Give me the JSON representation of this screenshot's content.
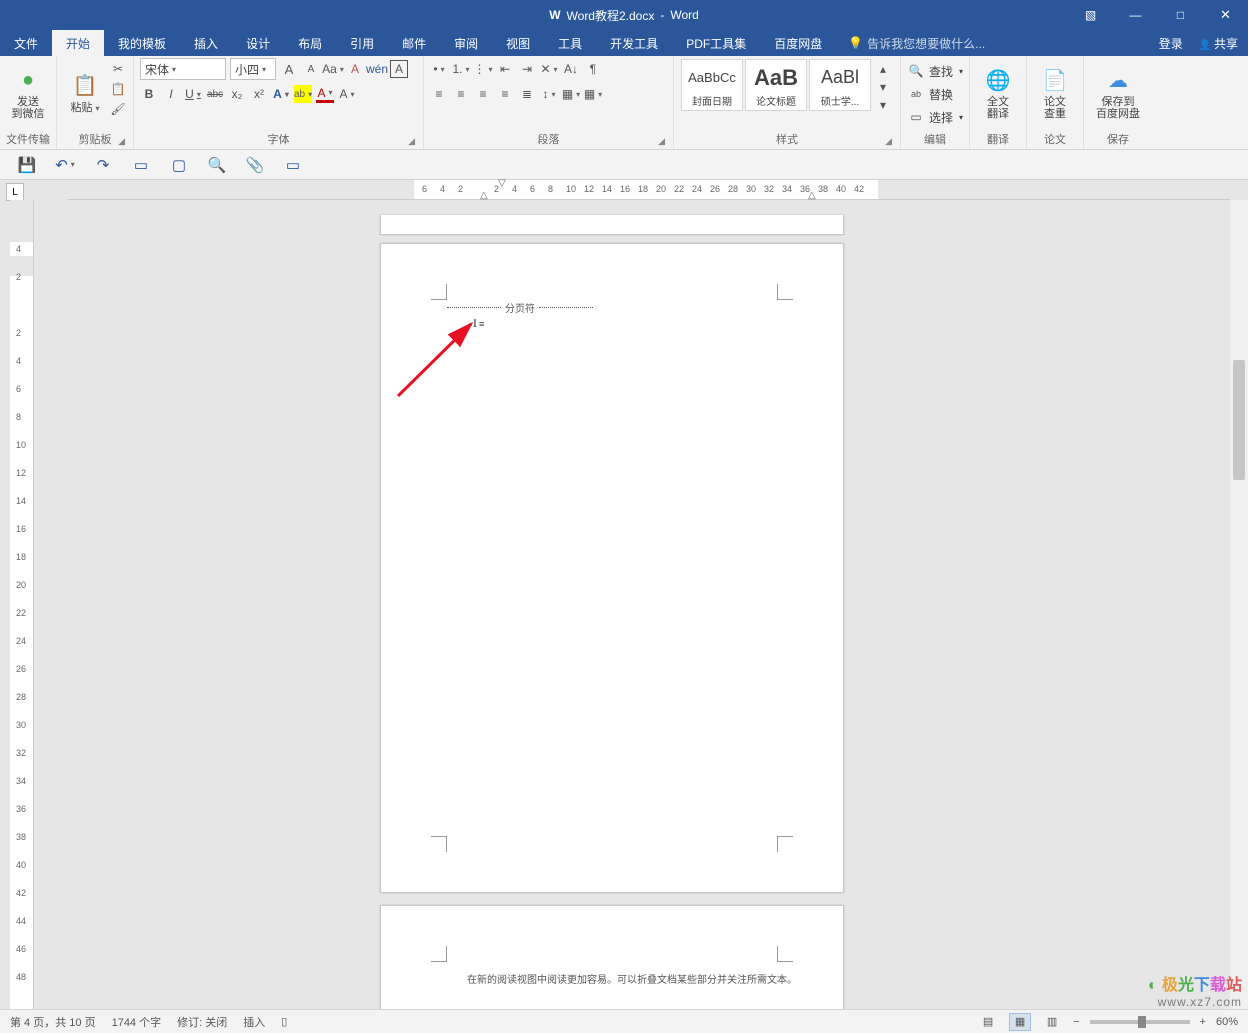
{
  "title": {
    "filename": "Word教程2.docx",
    "app": "Word"
  },
  "window_controls": {
    "ribbon_opts": "▧",
    "min": "—",
    "max": "□",
    "close": "✕"
  },
  "menu": {
    "tabs": [
      "文件",
      "开始",
      "我的模板",
      "插入",
      "设计",
      "布局",
      "引用",
      "邮件",
      "审阅",
      "视图",
      "工具",
      "开发工具",
      "PDF工具集",
      "百度网盘"
    ],
    "active_index": 1,
    "tell_me_icon": "💡",
    "tell_me": "告诉我您想要做什么...",
    "login": "登录",
    "share": "共享"
  },
  "ribbon": {
    "wechat": {
      "label": "发送\n到微信",
      "group": "文件传输"
    },
    "clipboard": {
      "paste": "粘贴",
      "cut_icon": "✂",
      "copy_icon": "📋",
      "brush_icon": "🖌",
      "group": "剪贴板"
    },
    "font": {
      "name": "宋体",
      "size": "小四",
      "grow": "A",
      "shrink": "A",
      "case": "Aa",
      "clear": "A",
      "phonetic": "wén",
      "charborder": "A",
      "bold": "B",
      "italic": "I",
      "underline": "U",
      "strike": "abc",
      "sub": "x₂",
      "sup": "x²",
      "effects": "A",
      "highlight": "ab",
      "color": "A",
      "shade": "A",
      "group": "字体"
    },
    "paragraph": {
      "bullets": "•",
      "numbers": "1.",
      "multilevel": "⋮",
      "dec_indent": "⇤",
      "inc_indent": "⇥",
      "sort": "A↓",
      "showmarks": "¶",
      "align_l": "≡",
      "align_c": "≡",
      "align_r": "≡",
      "align_j": "≡",
      "spacing": "↕",
      "shading": "▦",
      "borders": "▦",
      "group": "段落"
    },
    "styles": {
      "items": [
        {
          "preview": "AaBbCc",
          "name": "封面日期"
        },
        {
          "preview": "AaB",
          "name": "论文标题",
          "big": true
        },
        {
          "preview": "AaBl",
          "name": "硕士学..."
        }
      ],
      "group": "样式"
    },
    "editing": {
      "find": "查找",
      "replace": "替换",
      "select": "选择",
      "find_icon": "🔍",
      "replace_icon": "ab",
      "select_icon": "▭",
      "group": "编辑"
    },
    "translate": {
      "label": "全文\n翻译",
      "group": "翻译"
    },
    "thesis": {
      "label": "论文\n查重",
      "group": "论文"
    },
    "save_cloud": {
      "label": "保存到\n百度网盘",
      "group": "保存"
    }
  },
  "qat": {
    "save": "💾",
    "undo": "↶",
    "redo": "↷",
    "spread": "▭",
    "new": "▢",
    "preview": "🔍",
    "attach": "📎",
    "mode": "▭"
  },
  "ruler": {
    "tab_selector": "L",
    "marks": [
      "6",
      "4",
      "2",
      "",
      "2",
      "4",
      "6",
      "8",
      "10",
      "12",
      "14",
      "16",
      "18",
      "20",
      "22",
      "24",
      "26",
      "28",
      "30",
      "32",
      "34",
      "36",
      "38",
      "40",
      "42"
    ]
  },
  "vruler": {
    "marks": [
      "4",
      "2",
      "",
      "2",
      "4",
      "6",
      "8",
      "10",
      "12",
      "14",
      "16",
      "18",
      "20",
      "22",
      "24",
      "26",
      "28",
      "30",
      "32",
      "34",
      "36",
      "38",
      "40",
      "42",
      "44",
      "46",
      "48"
    ]
  },
  "document": {
    "page_break_label": "分页符",
    "body_text": "在新的阅读视图中阅读更加容易。可以折叠文档某些部分并关注所需文本。"
  },
  "status": {
    "page": "第 4 页，共 10 页",
    "words": "1744 个字",
    "track": "修订: 关闭",
    "mode": "插入",
    "lang_icon": "▯",
    "zoom": "60%"
  },
  "watermark": {
    "brand_chars": [
      "极",
      "光",
      "下",
      "载",
      "站"
    ],
    "url": "www.xz7.com"
  }
}
